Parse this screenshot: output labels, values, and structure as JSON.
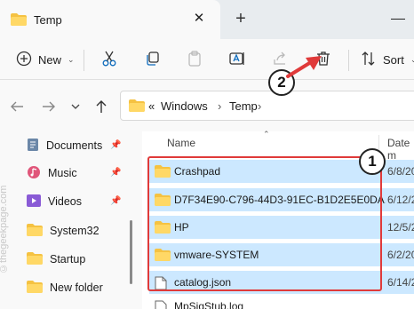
{
  "tab": {
    "title": "Temp",
    "close_glyph": "✕",
    "new_tab_glyph": "+"
  },
  "toolbar": {
    "new_label": "New",
    "sort_label": "Sort",
    "icons": [
      "cut-icon",
      "copy-icon",
      "paste-icon",
      "rename-icon",
      "share-icon",
      "delete-icon"
    ]
  },
  "address": {
    "prefix": "«",
    "crumb1": "Windows",
    "sep": "›",
    "crumb2": "Temp",
    "sep2": "›"
  },
  "sidebar": {
    "watermark": "©thegeekpage.com",
    "items": [
      {
        "label": "Documents",
        "icon": "documents-icon",
        "pinned": true
      },
      {
        "label": "Music",
        "icon": "music-icon",
        "pinned": true
      },
      {
        "label": "Videos",
        "icon": "videos-icon",
        "pinned": true
      },
      {
        "label": "System32",
        "icon": "folder-icon",
        "pinned": false
      },
      {
        "label": "Startup",
        "icon": "folder-icon",
        "pinned": false
      },
      {
        "label": "New folder",
        "icon": "folder-icon",
        "pinned": false
      }
    ]
  },
  "columns": {
    "name": "Name",
    "date": "Date m"
  },
  "files": [
    {
      "name": "Crashpad",
      "date": "6/8/20",
      "type": "folder"
    },
    {
      "name": "D7F34E90-C796-44D3-91EC-B1D2E5E0DA...",
      "date": "6/12/2",
      "type": "folder"
    },
    {
      "name": "HP",
      "date": "12/5/2",
      "type": "folder"
    },
    {
      "name": "vmware-SYSTEM",
      "date": "6/2/20",
      "type": "folder"
    },
    {
      "name": "catalog.json",
      "date": "6/14/2",
      "type": "file"
    }
  ],
  "partial_file": {
    "name": "MpSigStub.log"
  },
  "annotations": {
    "badge1": "1",
    "badge2": "2",
    "accent": "#e03a3a",
    "selection": "#cce8ff"
  }
}
